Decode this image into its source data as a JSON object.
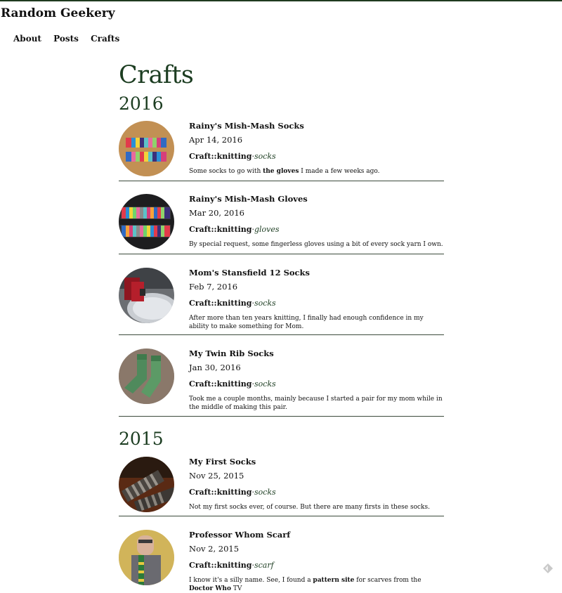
{
  "site": {
    "title": "Random Geekery"
  },
  "nav": {
    "items": [
      "About",
      "Posts",
      "Crafts"
    ]
  },
  "page": {
    "title": "Crafts"
  },
  "years": [
    "2016",
    "2015"
  ],
  "posts": [
    {
      "title": "Rainy's Mish-Mash Socks",
      "date": "Apr 14, 2016",
      "category": "Craft::knitting",
      "sep": "·",
      "tag": "socks",
      "desc_pre": "Some socks to go with ",
      "desc_link": "the gloves",
      "desc_post": " I made a few weeks ago."
    },
    {
      "title": "Rainy's Mish-Mash Gloves",
      "date": "Mar 20, 2016",
      "category": "Craft::knitting",
      "sep": "·",
      "tag": "gloves",
      "desc": "By special request, some fingerless gloves using a bit of every sock yarn I own."
    },
    {
      "title": "Mom's Stansfield 12 Socks",
      "date": "Feb 7, 2016",
      "category": "Craft::knitting",
      "sep": "·",
      "tag": "socks",
      "desc": "After more than ten years knitting, I finally had enough confidence in my ability to make something for Mom."
    },
    {
      "title": "My Twin Rib Socks",
      "date": "Jan 30, 2016",
      "category": "Craft::knitting",
      "sep": "·",
      "tag": "socks",
      "desc": "Took me a couple months, mainly because I started a pair for my mom while in the middle of making this pair."
    },
    {
      "title": "My First Socks",
      "date": "Nov 25, 2015",
      "category": "Craft::knitting",
      "sep": "·",
      "tag": "socks",
      "desc": "Not my first socks ever, of course. But there are many firsts in these socks."
    },
    {
      "title": "Professor Whom Scarf",
      "date": "Nov 2, 2015",
      "category": "Craft::knitting",
      "sep": "·",
      "tag": "scarf",
      "desc_pre": "I know it's a silly name. See, I found a ",
      "desc_link": "pattern site",
      "desc_mid": " for scarves from the ",
      "desc_link2": "Doctor Who",
      "desc_post": " TV"
    }
  ],
  "colors": {
    "accent": "#1c3d21",
    "rule": "#3b4a3b"
  },
  "icons": {
    "corner": "sun-icon"
  }
}
